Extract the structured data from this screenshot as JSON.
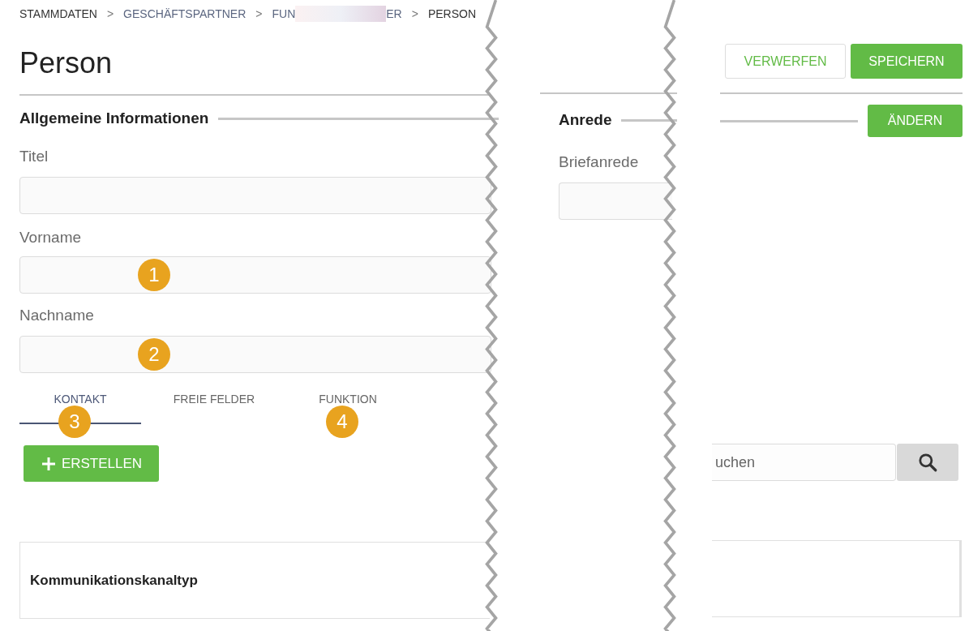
{
  "breadcrumb": [
    {
      "kind": "text",
      "label": "STAMMDATEN"
    },
    {
      "kind": "separator",
      "label": ">"
    },
    {
      "kind": "link",
      "label": "GESCHÄFTSPARTNER"
    },
    {
      "kind": "separator",
      "label": ">"
    },
    {
      "kind": "redacted",
      "before": "FUN",
      "after": "ER"
    },
    {
      "kind": "separator",
      "label": ">"
    },
    {
      "kind": "text",
      "label": "PERSON"
    }
  ],
  "page_title": "Person",
  "header_buttons": [
    {
      "label": "VERWERFEN",
      "kind": "outline"
    },
    {
      "label": "SPEICHERN",
      "kind": "primary"
    }
  ],
  "general_section": {
    "title": "Allgemeine Informationen",
    "fields": [
      {
        "label": "Titel"
      },
      {
        "label": "Vorname",
        "callout": "1"
      },
      {
        "label": "Nachname",
        "callout": "2"
      }
    ]
  },
  "salutation_section": {
    "title": "Anrede",
    "button": "ÄNDERN",
    "fields": [
      {
        "label": "Briefanrede"
      }
    ]
  },
  "tabs": [
    {
      "label": "KONTAKT",
      "selected": true,
      "callout": "3"
    },
    {
      "label": "FREIE FELDER",
      "selected": false
    },
    {
      "label": "FUNKTION",
      "selected": false,
      "callout": "4"
    }
  ],
  "create_button": {
    "label": "ERSTELLEN"
  },
  "search": {
    "placeholder": "uchen"
  },
  "table": {
    "columns": [
      "Kommunikationskanaltyp"
    ]
  }
}
